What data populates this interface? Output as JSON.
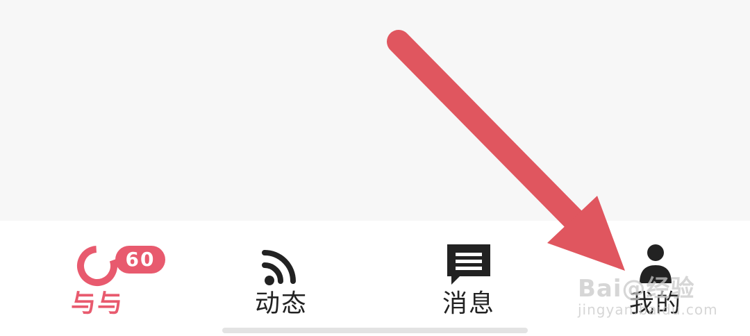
{
  "tabbar": {
    "tabs": [
      {
        "label": "与与",
        "icon": "yuyu-ring-icon",
        "active": true,
        "badge": "60"
      },
      {
        "label": "动态",
        "icon": "rss-feed-icon",
        "active": false
      },
      {
        "label": "消息",
        "icon": "message-bubble-icon",
        "active": false
      },
      {
        "label": "我的",
        "icon": "person-icon",
        "active": false
      }
    ]
  },
  "annotation": {
    "type": "arrow",
    "color": "#e0565f",
    "target": "tab-mine"
  },
  "watermark": {
    "line1": "Bai@经验",
    "line2": "jingyan.baidu.com"
  },
  "colors": {
    "accent": "#e85a6e",
    "text": "#222222",
    "background": "#f7f7f7"
  }
}
